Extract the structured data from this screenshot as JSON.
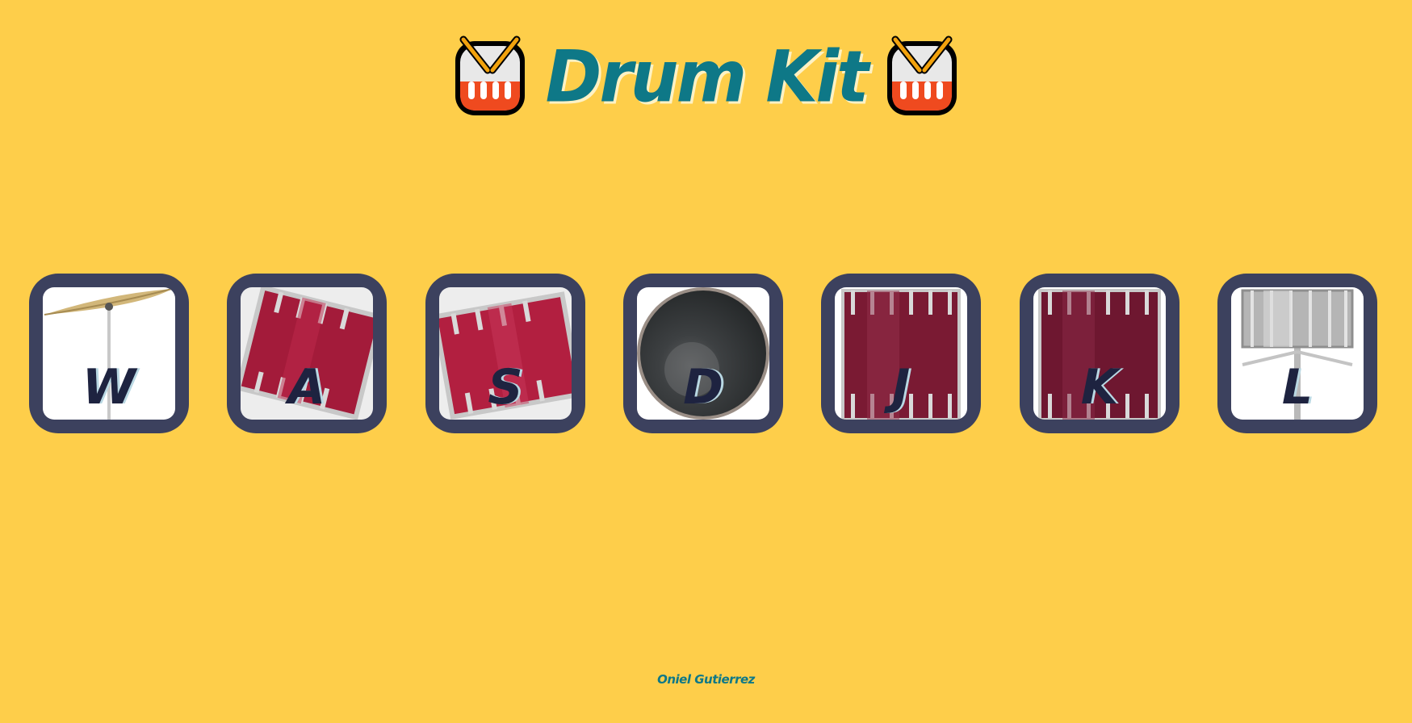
{
  "title": "Drum Kit",
  "drums": [
    {
      "key": "W",
      "instrument": "cymbal-icon"
    },
    {
      "key": "A",
      "instrument": "tom-icon"
    },
    {
      "key": "S",
      "instrument": "tom-icon"
    },
    {
      "key": "D",
      "instrument": "kick-drum-icon"
    },
    {
      "key": "J",
      "instrument": "floor-tom-icon"
    },
    {
      "key": "K",
      "instrument": "floor-tom-icon"
    },
    {
      "key": "L",
      "instrument": "snare-icon"
    }
  ],
  "footer": "Oniel Gutierrez",
  "colors": {
    "background": "#FECE4A",
    "title": "#0E7887",
    "pad_frame": "#3C415E",
    "key_text": "#1E2340",
    "drum_red": "#A31B3A",
    "drum_maroon": "#7A1A33"
  }
}
